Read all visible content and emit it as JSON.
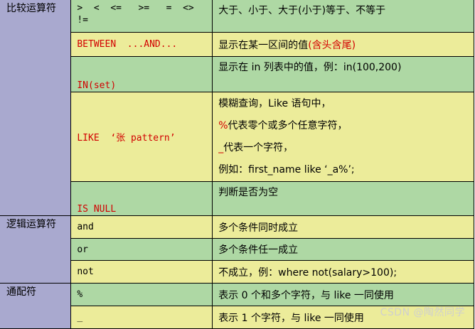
{
  "categories": {
    "compare": "比较运算符",
    "logic": "逻辑运算符",
    "wildcard": "通配符"
  },
  "rows": {
    "compare_ops": {
      "op_line1": ">  <  <=   >=   =  <>",
      "op_line2": "!=",
      "desc": "大于、小于、大于(小于)等于、不等于"
    },
    "between": {
      "op": "BETWEEN  ...AND...",
      "desc": "显示在某一区间的值",
      "desc_highlight": "(含头含尾)"
    },
    "in": {
      "op": "IN(set)",
      "desc": "显示在 in 列表中的值，例：in(100,200)"
    },
    "like": {
      "op": "LIKE  ‘张 pattern’",
      "desc_line1": "模糊查询，Like 语句中，",
      "desc_line2_mark": "%",
      "desc_line2": "代表零个或多个任意字符，",
      "desc_line3_mark": "_",
      "desc_line3": "代表一个字符，",
      "desc_line4": "例如：first_name like ‘_a%’;"
    },
    "is_null": {
      "op": "IS NULL",
      "desc": "判断是否为空"
    },
    "and": {
      "op": "and",
      "desc": "多个条件同时成立"
    },
    "or": {
      "op": "or",
      "desc": "多个条件任一成立"
    },
    "not": {
      "op": "not",
      "desc": "不成立，例：where not(salary>100);"
    },
    "percent": {
      "op": "%",
      "desc": "表示 0 个和多个字符，与 like 一同使用"
    },
    "underscore": {
      "op": "_",
      "desc": "表示 1 个字符，与 like 一同使用"
    }
  },
  "watermark": "CSDN @陶然同学",
  "colors": {
    "category_bg": "#a9a9cf",
    "yellow_row_bg": "#ecec9a",
    "green_row_bg": "#aed8a4",
    "highlight_red": "#d20000"
  }
}
